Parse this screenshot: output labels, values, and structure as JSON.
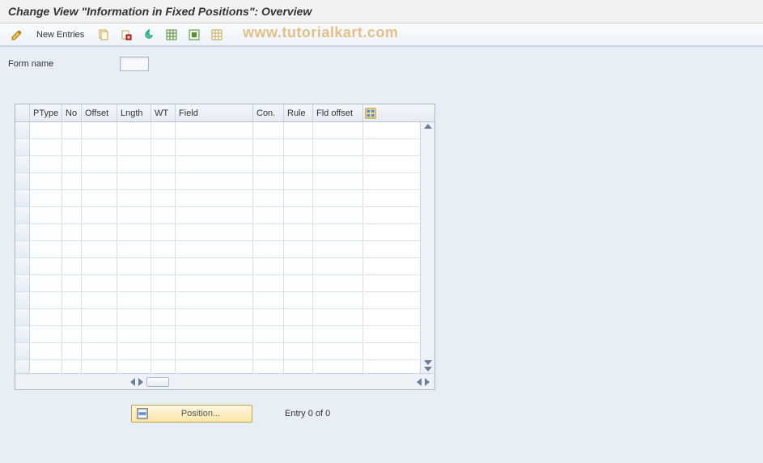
{
  "title": "Change View \"Information in Fixed Positions\": Overview",
  "toolbar": {
    "new_entries": "New Entries"
  },
  "watermark": "www.tutorialkart.com",
  "form": {
    "form_name_label": "Form name",
    "form_name_value": ""
  },
  "grid": {
    "columns": [
      "PType",
      "No",
      "Offset",
      "Lngth",
      "WT",
      "Field",
      "Con.",
      "Rule",
      "Fld offset"
    ],
    "rows": 15
  },
  "footer": {
    "position_label": "Position...",
    "entry_text": "Entry 0 of 0"
  }
}
